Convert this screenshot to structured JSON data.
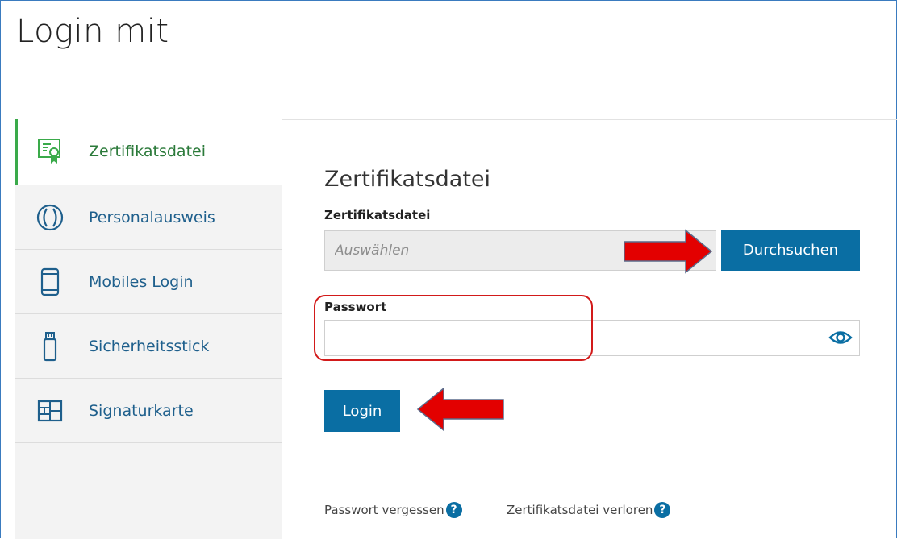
{
  "page": {
    "title": "Login mit"
  },
  "sidebar": {
    "items": [
      {
        "label": "Zertifikatsdatei",
        "icon": "certificate-icon",
        "active": true
      },
      {
        "label": "Personalausweis",
        "icon": "id-card-icon"
      },
      {
        "label": "Mobiles Login",
        "icon": "mobile-phone-icon"
      },
      {
        "label": "Sicherheitsstick",
        "icon": "usb-stick-icon"
      },
      {
        "label": "Signaturkarte",
        "icon": "smartcard-icon"
      }
    ]
  },
  "main": {
    "title": "Zertifikatsdatei",
    "file_label": "Zertifikatsdatei",
    "file_placeholder": "Auswählen",
    "browse_label": "Durchsuchen",
    "password_label": "Passwort",
    "password_value": "",
    "login_label": "Login",
    "forgot_password": "Passwort vergessen",
    "lost_certificate": "Zertifikatsdatei verloren",
    "help_glyph": "?"
  },
  "colors": {
    "primary": "#0a6ea3",
    "active_green": "#3aaa4a",
    "link_blue": "#1e5f8c",
    "annotation_red": "#d21a1a"
  }
}
